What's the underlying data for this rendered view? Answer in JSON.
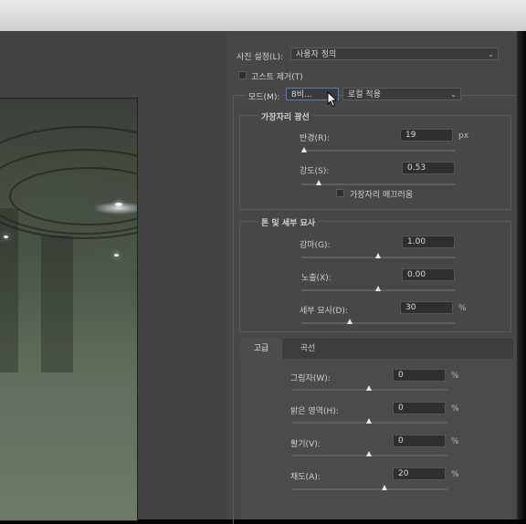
{
  "preset": {
    "label": "사진 설정(L):",
    "value": "사용자 정의"
  },
  "ghost": {
    "label": "고스트 제거(T)",
    "checked": false
  },
  "mode": {
    "label": "모드(M):",
    "bit_value": "8비...",
    "method_value": "로컬 적용"
  },
  "edge_glow": {
    "title": "가장자리 광선",
    "radius": {
      "label": "반경(R):",
      "value": "19",
      "unit": "px",
      "fraction": 0.02
    },
    "strength": {
      "label": "강도(S):",
      "value": "0.53",
      "fraction": 0.13
    },
    "smooth": {
      "label": "가장자리 매끄러움",
      "checked": false
    }
  },
  "tone": {
    "title": "톤 및 세부 묘사",
    "gamma": {
      "label": "감마(G):",
      "value": "1.00",
      "fraction": 0.5
    },
    "exposure": {
      "label": "노출(X):",
      "value": "0.00",
      "fraction": 0.5
    },
    "detail": {
      "label": "세부 묘사(D):",
      "value": "30",
      "unit": "%",
      "fraction": 0.33
    }
  },
  "tabs": {
    "advanced": "고급",
    "curve": "곡선"
  },
  "advanced": {
    "shadow": {
      "label": "그림자(W):",
      "value": "0",
      "unit": "%",
      "fraction": 0.5
    },
    "highlight": {
      "label": "밝은 영역(H):",
      "value": "0",
      "unit": "%",
      "fraction": 0.5
    },
    "vibrance": {
      "label": "활기(V):",
      "value": "0",
      "unit": "%",
      "fraction": 0.5
    },
    "saturation": {
      "label": "채도(A):",
      "value": "20",
      "unit": "%",
      "fraction": 0.6
    }
  }
}
